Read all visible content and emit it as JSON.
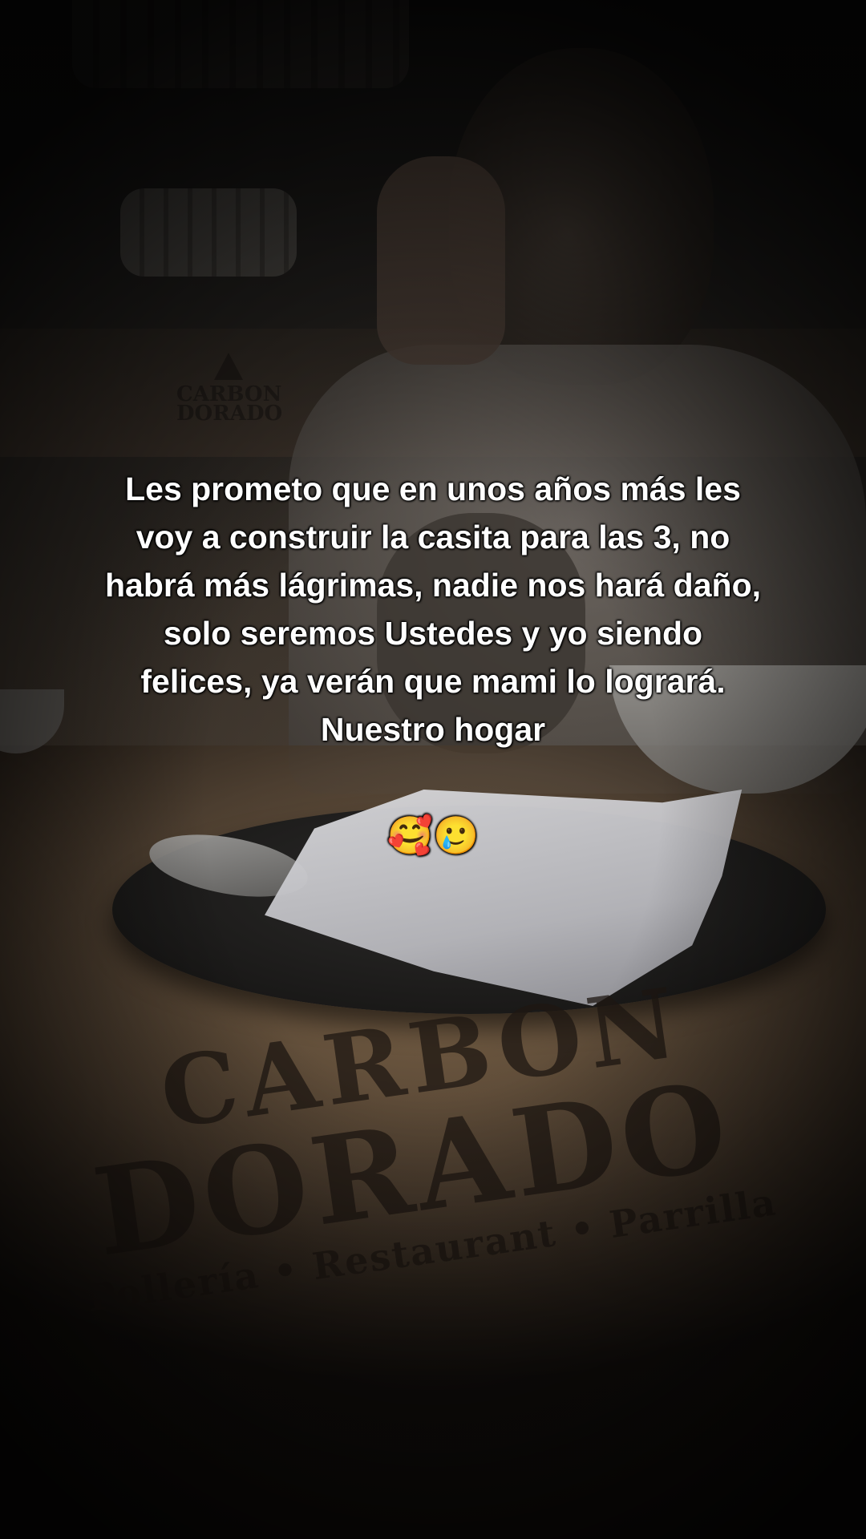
{
  "caption": {
    "lines": [
      "Les prometo que en unos años más les",
      "voy a construir la casita para las 3, no",
      "habrá más lágrimas, nadie nos hará daño,",
      "solo seremos Ustedes y yo siendo",
      "felices, ya verán que mami lo logrará.",
      "Nuestro hogar"
    ],
    "emoji": "🥰🥲"
  },
  "scene": {
    "booth_logo": [
      "CARBON",
      "DORADO"
    ],
    "table_logo": {
      "line1": "CARBON",
      "line2": "DORADO",
      "line3": "Pollería • Restaurant • Parrilla"
    }
  }
}
